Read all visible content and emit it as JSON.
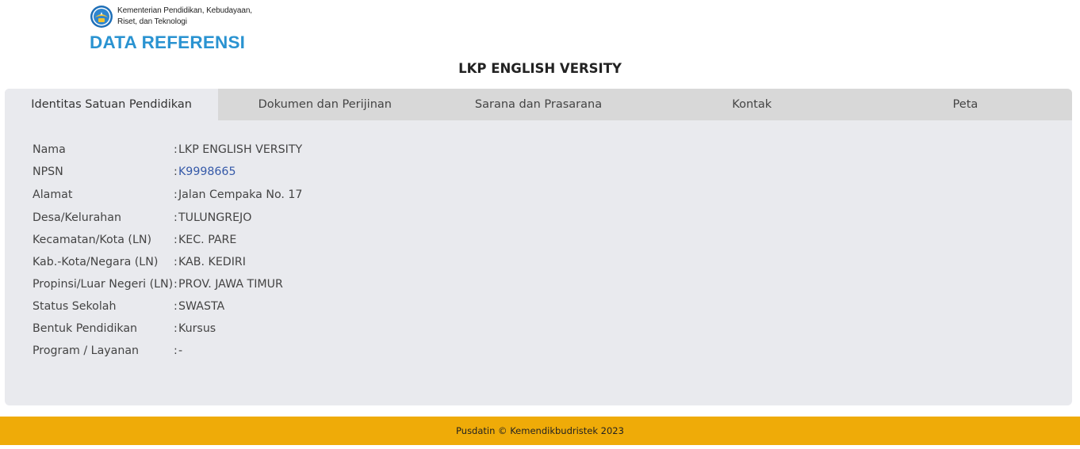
{
  "header": {
    "ministry_line1": "Kementerian Pendidikan, Kebudayaan,",
    "ministry_line2": "Riset, dan Teknologi",
    "brand": "DATA REFERENSI",
    "emblem_icon": "tut-wuri-handayani-emblem-icon"
  },
  "page_title": "LKP ENGLISH VERSITY",
  "tabs": [
    {
      "label": "Identitas Satuan Pendidikan",
      "active": true
    },
    {
      "label": "Dokumen dan Perijinan",
      "active": false
    },
    {
      "label": "Sarana dan Prasarana",
      "active": false
    },
    {
      "label": "Kontak",
      "active": false
    },
    {
      "label": "Peta",
      "active": false
    }
  ],
  "separator": ":",
  "fields": [
    {
      "label": "Nama",
      "value": "LKP ENGLISH VERSITY"
    },
    {
      "label": "NPSN",
      "value": "K9998665"
    },
    {
      "label": "Alamat",
      "value": "Jalan Cempaka No. 17"
    },
    {
      "label": "Desa/Kelurahan",
      "value": "TULUNGREJO"
    },
    {
      "label": "Kecamatan/Kota (LN)",
      "value": "KEC. PARE"
    },
    {
      "label": "Kab.-Kota/Negara (LN)",
      "value": "KAB. KEDIRI"
    },
    {
      "label": "Propinsi/Luar Negeri (LN)",
      "value": "PROV. JAWA TIMUR"
    },
    {
      "label": "Status Sekolah",
      "value": "SWASTA"
    },
    {
      "label": "Bentuk Pendidikan",
      "value": "Kursus"
    },
    {
      "label": "Program / Layanan",
      "value": "-"
    }
  ],
  "footer": "Pusdatin © Kemendikbudristek 2023",
  "colors": {
    "brand_blue": "#2a93d1",
    "footer_bg": "#efab08",
    "link": "#3559a8",
    "panel_bg": "#e9eaee",
    "tab_bar_bg": "#d8d8d8"
  }
}
